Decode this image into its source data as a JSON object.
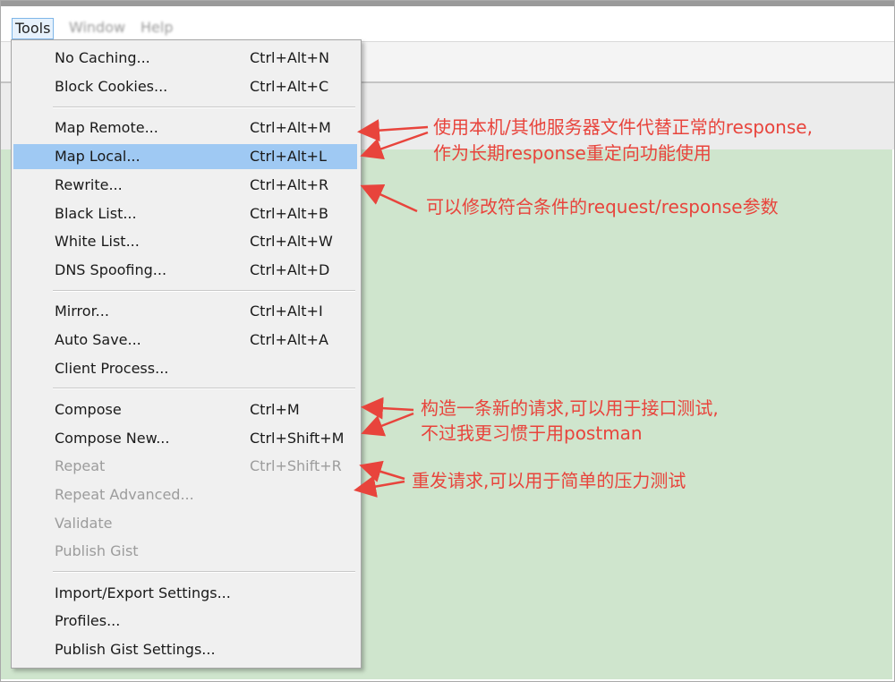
{
  "menubar": {
    "tools": "Tools",
    "window": "Window",
    "help": "Help"
  },
  "menu": {
    "items": [
      {
        "label": "No Caching...",
        "shortcut": "Ctrl+Alt+N"
      },
      {
        "label": "Block Cookies...",
        "shortcut": "Ctrl+Alt+C"
      },
      {
        "label": "Map Remote...",
        "shortcut": "Ctrl+Alt+M"
      },
      {
        "label": "Map Local...",
        "shortcut": "Ctrl+Alt+L"
      },
      {
        "label": "Rewrite...",
        "shortcut": "Ctrl+Alt+R"
      },
      {
        "label": "Black List...",
        "shortcut": "Ctrl+Alt+B"
      },
      {
        "label": "White List...",
        "shortcut": "Ctrl+Alt+W"
      },
      {
        "label": "DNS Spoofing...",
        "shortcut": "Ctrl+Alt+D"
      },
      {
        "label": "Mirror...",
        "shortcut": "Ctrl+Alt+I"
      },
      {
        "label": "Auto Save...",
        "shortcut": "Ctrl+Alt+A"
      },
      {
        "label": "Client Process...",
        "shortcut": ""
      },
      {
        "label": "Compose",
        "shortcut": "Ctrl+M"
      },
      {
        "label": "Compose New...",
        "shortcut": "Ctrl+Shift+M"
      },
      {
        "label": "Repeat",
        "shortcut": "Ctrl+Shift+R"
      },
      {
        "label": "Repeat Advanced...",
        "shortcut": ""
      },
      {
        "label": "Validate",
        "shortcut": ""
      },
      {
        "label": "Publish Gist",
        "shortcut": ""
      },
      {
        "label": "Import/Export Settings...",
        "shortcut": ""
      },
      {
        "label": "Profiles...",
        "shortcut": ""
      },
      {
        "label": "Publish Gist Settings...",
        "shortcut": ""
      }
    ]
  },
  "annotations": {
    "map": [
      "使用本机/其他服务器文件代替正常的response,",
      "作为长期response重定向功能使用"
    ],
    "rewrite": "可以修改符合条件的request/response参数",
    "compose": [
      "构造一条新的请求,可以用于接口测试,",
      "不过我更习惯于用postman"
    ],
    "repeat": "重发请求,可以用于简单的压力测试"
  },
  "colors": {
    "annotation": "#e8443c",
    "highlight": "#9fc9f3",
    "background_green": "#cfe5cd"
  }
}
